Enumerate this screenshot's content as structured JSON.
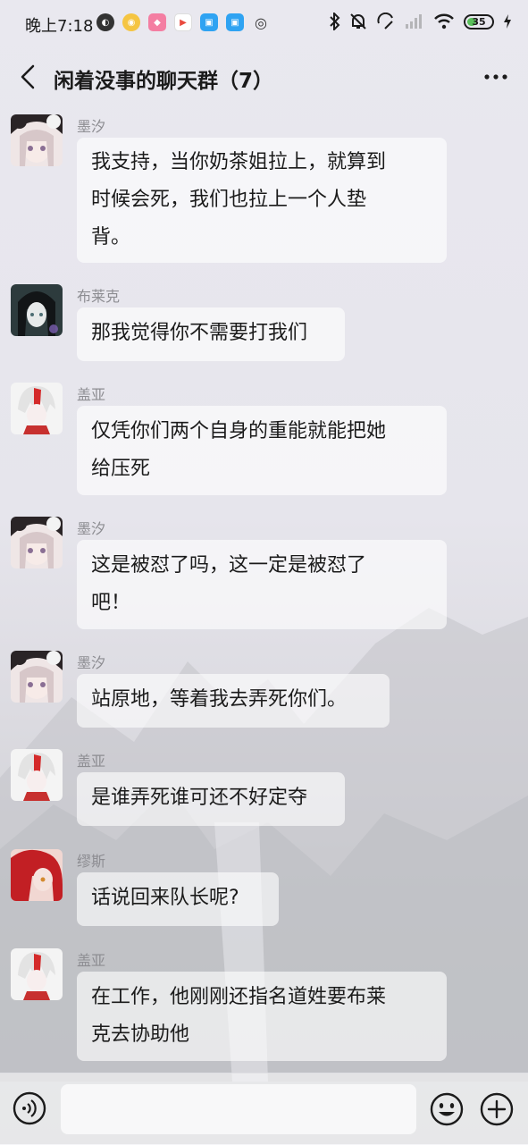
{
  "status_bar": {
    "time": "晚上7:18",
    "battery": "35"
  },
  "header": {
    "title": "闲着没事的聊天群（7）"
  },
  "messages": [
    {
      "sender": "墨汐",
      "text": "我支持，当你奶茶姐拉上，就算到\n时候会死，我们也拉上一个人垫\n背。",
      "avatar": "girl-bear-hat-avatar"
    },
    {
      "sender": "布莱克",
      "text": "那我觉得你不需要打我们",
      "avatar": "dark-hair-avatar"
    },
    {
      "sender": "盖亚",
      "text": "仅凭你们两个自身的重能就能把她\n给压死",
      "avatar": "white-red-hair-avatar"
    },
    {
      "sender": "墨汐",
      "text": "这是被怼了吗，这一定是被怼了\n吧！",
      "avatar": "girl-bear-hat-avatar"
    },
    {
      "sender": "墨汐",
      "text": "站原地，等着我去弄死你们。",
      "avatar": "girl-bear-hat-avatar"
    },
    {
      "sender": "盖亚",
      "text": "是谁弄死谁可还不好定夺",
      "avatar": "white-red-hair-avatar"
    },
    {
      "sender": "缪斯",
      "text": "话说回来队长呢?",
      "avatar": "red-hair-avatar"
    },
    {
      "sender": "盖亚",
      "text": "在工作，他刚刚还指名道姓要布莱\n克去协助他",
      "avatar": "white-red-hair-avatar"
    }
  ],
  "input": {
    "placeholder": ""
  },
  "colors": {
    "bubble": "#ffffff",
    "sender_name": "#8d8d92",
    "text": "#1b1b1b",
    "battery_fill": "#59c05a"
  }
}
